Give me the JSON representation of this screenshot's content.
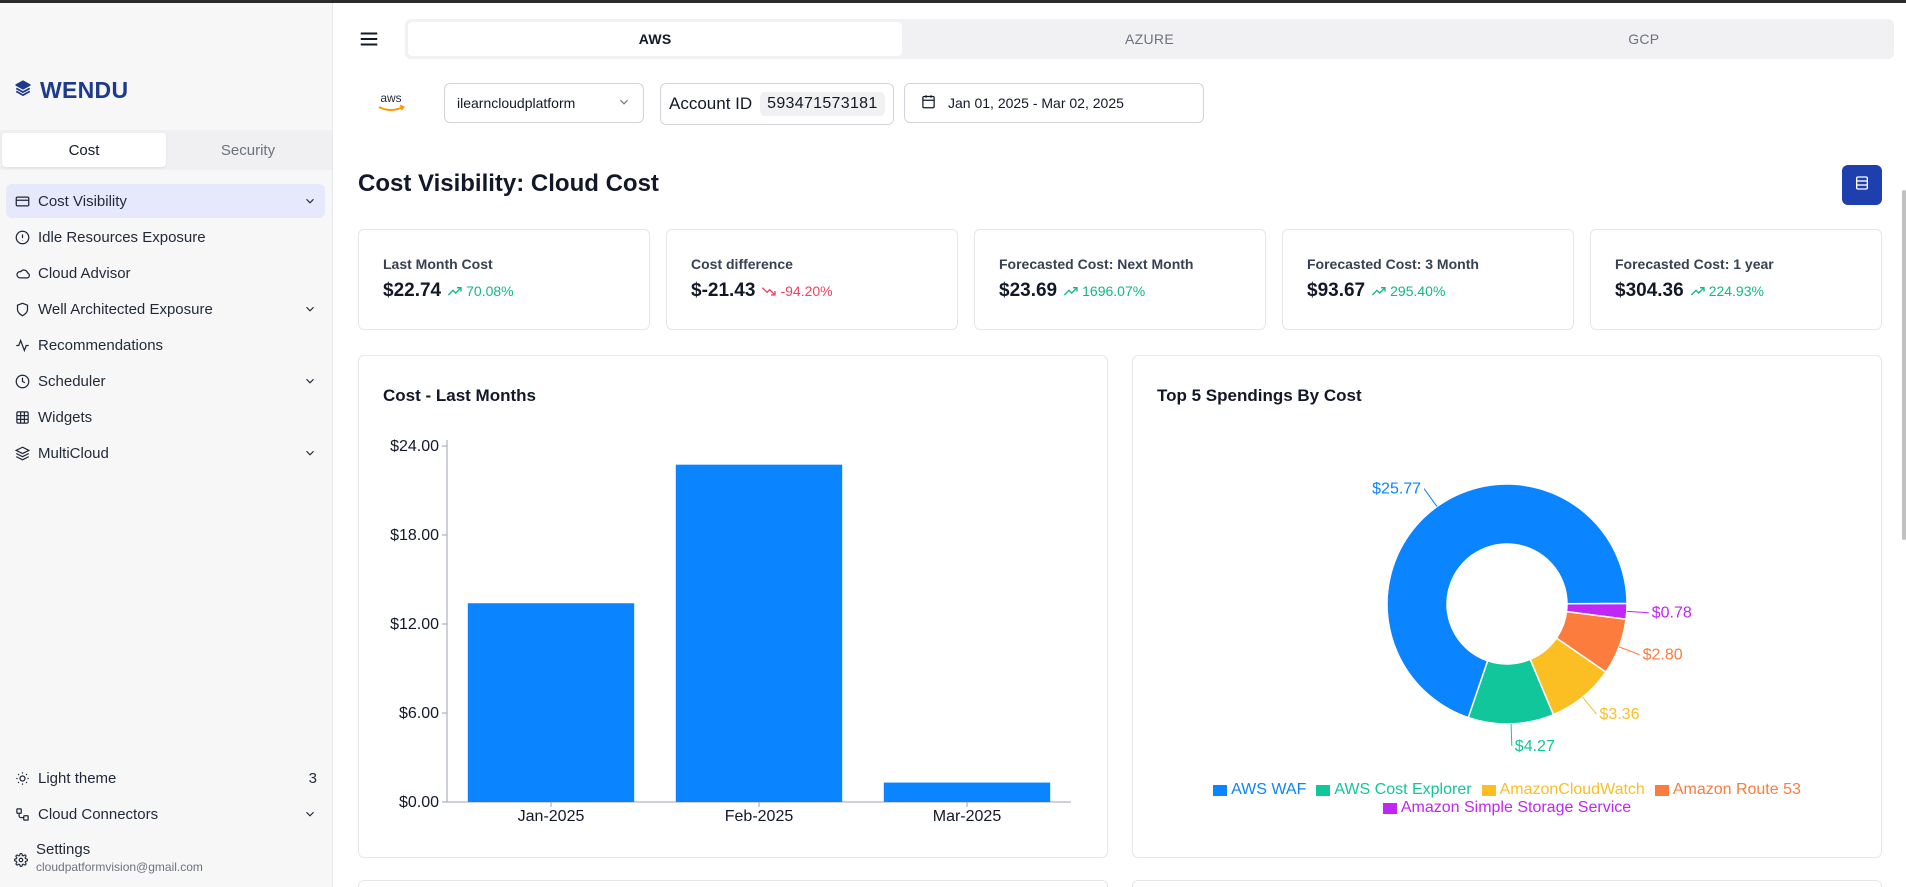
{
  "brand": {
    "name": "WENDU"
  },
  "sidebar": {
    "segments": [
      {
        "label": "Cost",
        "active": true
      },
      {
        "label": "Security",
        "active": false
      }
    ],
    "items": [
      {
        "label": "Cost Visibility",
        "icon": "credit-card-icon",
        "expandable": true,
        "active": true
      },
      {
        "label": "Idle Resources Exposure",
        "icon": "alert-circle-icon",
        "expandable": false
      },
      {
        "label": "Cloud Advisor",
        "icon": "cloud-icon",
        "expandable": false
      },
      {
        "label": "Well Architected Exposure",
        "icon": "shield-icon",
        "expandable": true
      },
      {
        "label": "Recommendations",
        "icon": "activity-icon",
        "expandable": false
      },
      {
        "label": "Scheduler",
        "icon": "clock-icon",
        "expandable": true
      },
      {
        "label": "Widgets",
        "icon": "grid-icon",
        "expandable": false
      },
      {
        "label": "MultiCloud",
        "icon": "layers-icon",
        "expandable": true
      }
    ],
    "bottom": {
      "theme_label": "Light theme",
      "theme_count": "3",
      "connectors_label": "Cloud Connectors",
      "settings_label": "Settings",
      "email": "cloudpatformvision@gmail.com"
    }
  },
  "cloud_tabs": [
    {
      "label": "AWS",
      "active": true
    },
    {
      "label": "AZURE",
      "active": false
    },
    {
      "label": "GCP",
      "active": false
    }
  ],
  "filters": {
    "provider_logo": "aws",
    "account_select": "ilearncloudplatform",
    "account_label": "Account ID",
    "account_id": "593471573181",
    "date_range": "Jan 01, 2025 - Mar 02, 2025"
  },
  "page_title": "Cost Visibility: Cloud Cost",
  "kpis": [
    {
      "title": "Last Month Cost",
      "value": "$22.74",
      "delta": "70.08%",
      "trend": "up"
    },
    {
      "title": "Cost difference",
      "value": "$-21.43",
      "delta": "-94.20%",
      "trend": "down"
    },
    {
      "title": "Forecasted Cost: Next Month",
      "value": "$23.69",
      "delta": "1696.07%",
      "trend": "up"
    },
    {
      "title": "Forecasted Cost: 3 Month",
      "value": "$93.67",
      "delta": "295.40%",
      "trend": "up"
    },
    {
      "title": "Forecasted Cost: 1 year",
      "value": "$304.36",
      "delta": "224.93%",
      "trend": "up"
    }
  ],
  "colors": {
    "accent": "#1e40af",
    "bar": "#0a84ff",
    "up": "#10b981",
    "down": "#f43f5e"
  },
  "chart_data": [
    {
      "type": "bar",
      "title": "Cost - Last Months",
      "categories": [
        "Jan-2025",
        "Feb-2025",
        "Mar-2025"
      ],
      "values": [
        13.4,
        22.74,
        1.31
      ],
      "yticks": [
        "$0.00",
        "$6.00",
        "$12.00",
        "$18.00",
        "$24.00"
      ],
      "ylim": [
        0,
        24
      ],
      "color": "#0a84ff"
    },
    {
      "type": "pie",
      "title": "Top 5 Spendings By Cost",
      "donut": true,
      "slices": [
        {
          "name": "AWS WAF",
          "value": 25.77,
          "label": "$25.77",
          "color": "#0a84ff"
        },
        {
          "name": "AWS Cost Explorer",
          "value": 4.27,
          "label": "$4.27",
          "color": "#10c69a"
        },
        {
          "name": "AmazonCloudWatch",
          "value": 3.36,
          "label": "$3.36",
          "color": "#fbbf24"
        },
        {
          "name": "Amazon Route 53",
          "value": 2.8,
          "label": "$2.80",
          "color": "#fb7c3c"
        },
        {
          "name": "Amazon Simple Storage Service",
          "value": 0.78,
          "label": "$0.78",
          "color": "#c026f5"
        }
      ]
    }
  ]
}
